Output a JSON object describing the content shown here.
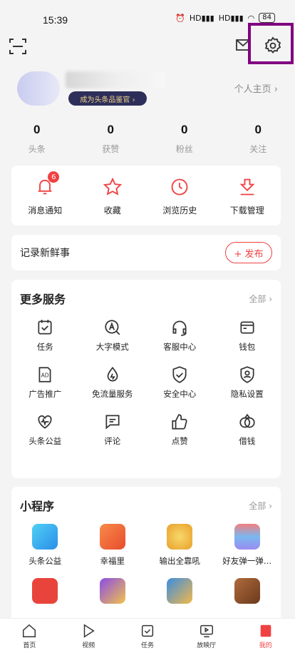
{
  "status_bar": {
    "time": "15:39",
    "signal_1": "HD",
    "signal_2": "HD",
    "battery": "84"
  },
  "profile": {
    "badge_text": "成为头条品鉴官 ›",
    "homepage_link": "个人主页 ›"
  },
  "stats": [
    {
      "value": "0",
      "label": "头条"
    },
    {
      "value": "0",
      "label": "获赞"
    },
    {
      "value": "0",
      "label": "粉丝"
    },
    {
      "value": "0",
      "label": "关注"
    }
  ],
  "quick_actions": [
    {
      "label": "消息通知",
      "icon": "bell-icon",
      "badge": "6"
    },
    {
      "label": "收藏",
      "icon": "star-icon"
    },
    {
      "label": "浏览历史",
      "icon": "clock-icon"
    },
    {
      "label": "下载管理",
      "icon": "download-icon"
    }
  ],
  "post": {
    "title": "记录新鲜事",
    "button": "+ 发布"
  },
  "more_services": {
    "title": "更多服务",
    "all": "全部 ›",
    "items": [
      {
        "label": "任务",
        "icon": "task-icon"
      },
      {
        "label": "大字模式",
        "icon": "large-font-icon"
      },
      {
        "label": "客服中心",
        "icon": "headset-icon"
      },
      {
        "label": "钱包",
        "icon": "wallet-icon"
      },
      {
        "label": "广告推广",
        "icon": "ad-icon"
      },
      {
        "label": "免流量服务",
        "icon": "data-free-icon"
      },
      {
        "label": "安全中心",
        "icon": "shield-icon"
      },
      {
        "label": "隐私设置",
        "icon": "privacy-icon"
      },
      {
        "label": "头条公益",
        "icon": "charity-icon"
      },
      {
        "label": "评论",
        "icon": "comment-icon"
      },
      {
        "label": "点赞",
        "icon": "thumbs-up-icon"
      },
      {
        "label": "借钱",
        "icon": "loan-icon"
      }
    ]
  },
  "mini_programs": {
    "title": "小程序",
    "all": "全部 ›",
    "items": [
      {
        "label": "头条公益",
        "color": "#3fb4f0"
      },
      {
        "label": "幸福里",
        "color": "#f26b3a"
      },
      {
        "label": "输出全靠吼",
        "color": "#f5c542"
      },
      {
        "label": "好友弹一弹…",
        "color": "#8a7be8"
      },
      {
        "label": "",
        "color": "#e8443c"
      },
      {
        "label": "",
        "color": "#7a4cd8"
      },
      {
        "label": "",
        "color": "#3b8de0"
      },
      {
        "label": "",
        "color": "#9a5a34"
      }
    ]
  },
  "tabbar": [
    {
      "label": "首页",
      "icon": "home-icon"
    },
    {
      "label": "视频",
      "icon": "play-icon"
    },
    {
      "label": "任务",
      "icon": "task-tab-icon"
    },
    {
      "label": "放映厅",
      "icon": "screen-icon"
    },
    {
      "label": "我的",
      "icon": "profile-tab-icon",
      "active": true
    }
  ],
  "colors": {
    "accent": "#f04142",
    "highlight_box": "#800080"
  }
}
